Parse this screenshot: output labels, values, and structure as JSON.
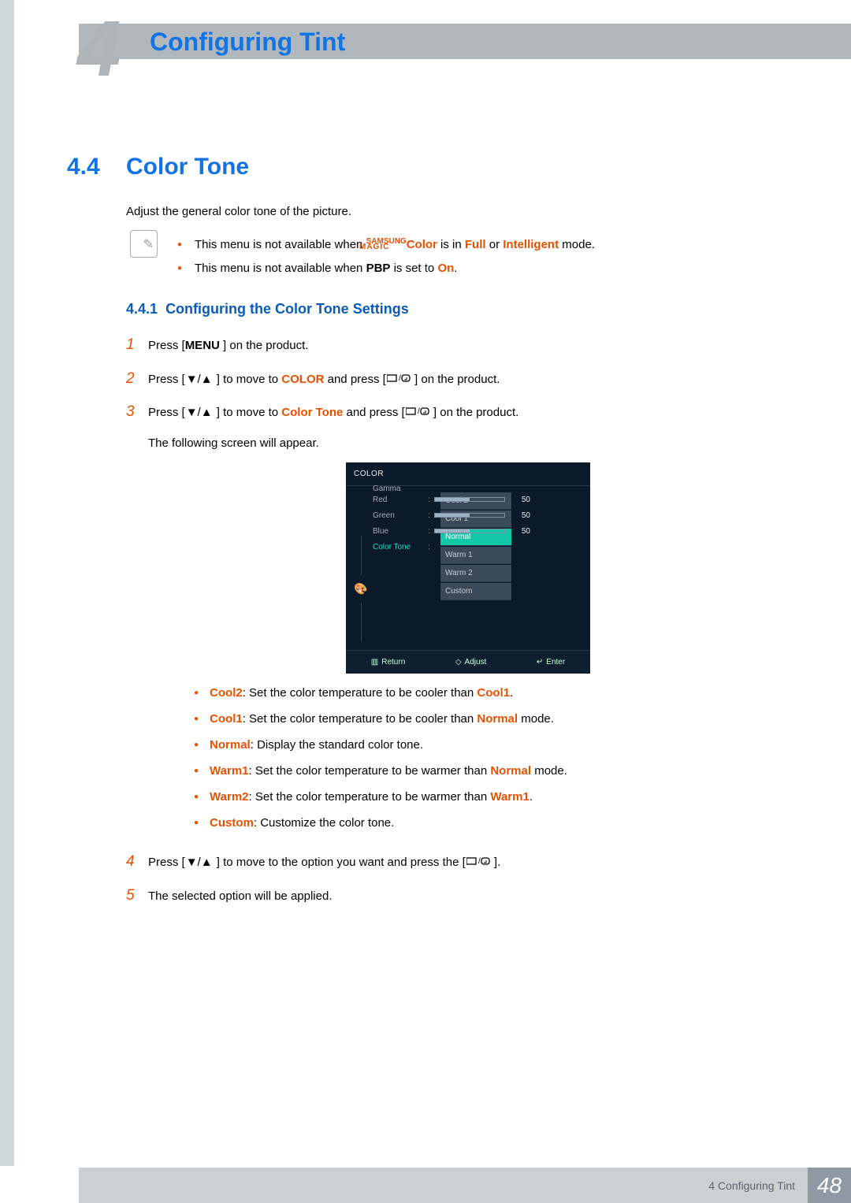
{
  "header": {
    "chapter_big": "4",
    "title": "Configuring Tint"
  },
  "section": {
    "number": "4.4",
    "title": "Color Tone",
    "intro": "Adjust the general color tone of the picture."
  },
  "notes": {
    "n1_pre": "This menu is not available when ",
    "n1_magic_top": "SAMSUNG",
    "n1_magic_bot": "MAGIC",
    "n1_color": "Color",
    "n1_mid": " is in ",
    "n1_full": "Full",
    "n1_or": " or ",
    "n1_intel": "Intelligent",
    "n1_post": " mode.",
    "n2_pre": "This menu is not available when ",
    "n2_pbp": "PBP",
    "n2_mid": " is set to ",
    "n2_on": "On",
    "n2_post": "."
  },
  "subsection": {
    "number": "4.4.1",
    "title": "Configuring the Color Tone Settings"
  },
  "steps": {
    "s1_pre": "Press [",
    "s1_menu": "MENU",
    "s1_post": " ] on the product.",
    "s2_pre": "Press [",
    "s2_mid": " ] to move to ",
    "s2_color": "COLOR",
    "s2_and": " and press [",
    "s2_post": " ] on the product.",
    "s3_pre": "Press [",
    "s3_mid": " ] to move to ",
    "s3_ct": "Color Tone",
    "s3_and": " and press [",
    "s3_post": " ] on the product.",
    "s3_follow": "The following screen will appear.",
    "s4_pre": "Press [",
    "s4_mid": " ] to move to the option you want and press the [",
    "s4_post": " ].",
    "s5": "The selected option will be applied."
  },
  "osd": {
    "menu_title": "COLOR",
    "rows": {
      "red": {
        "label": "Red",
        "value": "50"
      },
      "green": {
        "label": "Green",
        "value": "50"
      },
      "blue": {
        "label": "Blue",
        "value": "50"
      },
      "color_tone": {
        "label": "Color Tone"
      },
      "gamma": {
        "label": "Gamma"
      }
    },
    "options": [
      "Cool 2",
      "Cool 1",
      "Normal",
      "Warm 1",
      "Warm 2",
      "Custom"
    ],
    "selected_option": "Normal",
    "footer": {
      "return": "Return",
      "adjust": "Adjust",
      "enter": "Enter"
    }
  },
  "descriptions": {
    "cool2_k": "Cool2",
    "cool2_v_pre": ": Set the color temperature to be cooler than ",
    "cool2_ref": "Cool1",
    "cool2_v_post": ".",
    "cool1_k": "Cool1",
    "cool1_v_pre": ": Set the color temperature to be cooler than ",
    "cool1_ref": "Normal",
    "cool1_v_post": " mode.",
    "normal_k": "Normal",
    "normal_v": ": Display the standard color tone.",
    "warm1_k": "Warm1",
    "warm1_v_pre": ": Set the color temperature to be warmer than ",
    "warm1_ref": "Normal",
    "warm1_v_post": " mode.",
    "warm2_k": "Warm2",
    "warm2_v_pre": ": Set the color temperature to be warmer than ",
    "warm2_ref": "Warm1",
    "warm2_v_post": ".",
    "custom_k": "Custom",
    "custom_v": ": Customize the color tone."
  },
  "footer": {
    "chapter": "4 Configuring Tint",
    "page": "48"
  }
}
